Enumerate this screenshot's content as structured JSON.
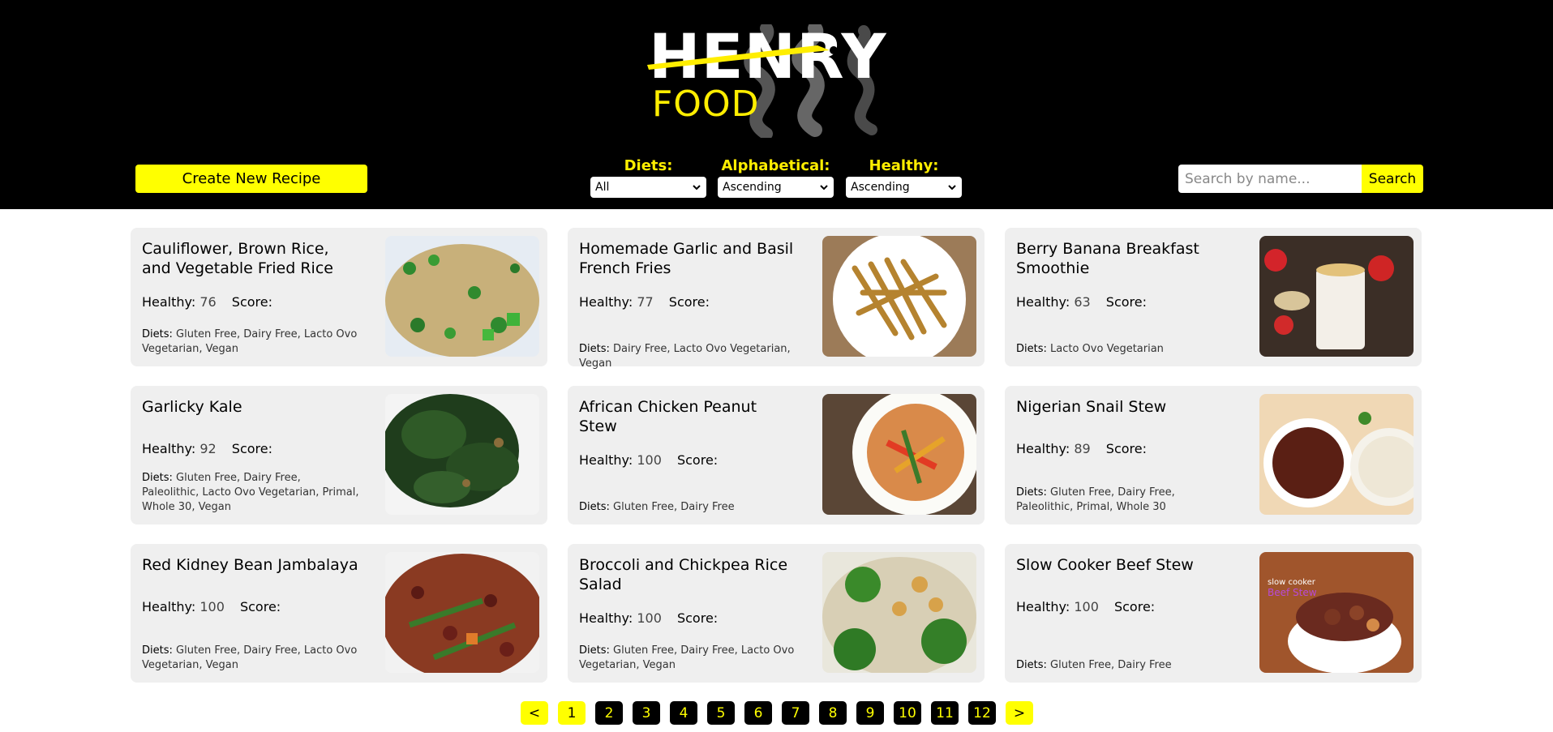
{
  "header": {
    "logo_top": "HENRY",
    "logo_bottom": "FOOD",
    "create_button": "Create New Recipe",
    "filters": [
      {
        "label": "Diets:",
        "selected": "All"
      },
      {
        "label": "Alphabetical:",
        "selected": "Ascending"
      },
      {
        "label": "Healthy:",
        "selected": "Ascending"
      }
    ],
    "search": {
      "placeholder": "Search by name...",
      "button": "Search"
    }
  },
  "labels": {
    "healthy": "Healthy:",
    "score": "Score:",
    "diets": "Diets:"
  },
  "recipes": [
    {
      "title": "Cauliflower, Brown Rice, and Vegetable Fried Rice",
      "healthy": "76",
      "diets": "Gluten Free, Dairy Free, Lacto Ovo Vegetarian, Vegan",
      "image": "fried-rice"
    },
    {
      "title": "Homemade Garlic and Basil French Fries",
      "healthy": "77",
      "diets": "Dairy Free, Lacto Ovo Vegetarian, Vegan",
      "image": "french-fries"
    },
    {
      "title": "Berry Banana Breakfast Smoothie",
      "healthy": "63",
      "diets": "Lacto Ovo Vegetarian",
      "image": "smoothie"
    },
    {
      "title": "Garlicky Kale",
      "healthy": "92",
      "diets": "Gluten Free, Dairy Free, Paleolithic, Lacto Ovo Vegetarian, Primal, Whole 30, Vegan",
      "image": "kale"
    },
    {
      "title": "African Chicken Peanut Stew",
      "healthy": "100",
      "diets": "Gluten Free, Dairy Free",
      "image": "peanut-stew"
    },
    {
      "title": "Nigerian Snail Stew",
      "healthy": "89",
      "diets": "Gluten Free, Dairy Free, Paleolithic, Primal, Whole 30",
      "image": "snail-stew"
    },
    {
      "title": "Red Kidney Bean Jambalaya",
      "healthy": "100",
      "diets": "Gluten Free, Dairy Free, Lacto Ovo Vegetarian, Vegan",
      "image": "jambalaya"
    },
    {
      "title": "Broccoli and Chickpea Rice Salad",
      "healthy": "100",
      "diets": "Gluten Free, Dairy Free, Lacto Ovo Vegetarian, Vegan",
      "image": "broccoli-salad"
    },
    {
      "title": "Slow Cooker Beef Stew",
      "healthy": "100",
      "diets": "Gluten Free, Dairy Free",
      "image": "beef-stew"
    }
  ],
  "pagination": {
    "prev": "<",
    "next": ">",
    "current": 1,
    "pages": [
      "1",
      "2",
      "3",
      "4",
      "5",
      "6",
      "7",
      "8",
      "9",
      "10",
      "11",
      "12"
    ]
  },
  "colors": {
    "accent": "#ffff00",
    "header_bg": "#000000",
    "card_bg": "#efefef"
  }
}
